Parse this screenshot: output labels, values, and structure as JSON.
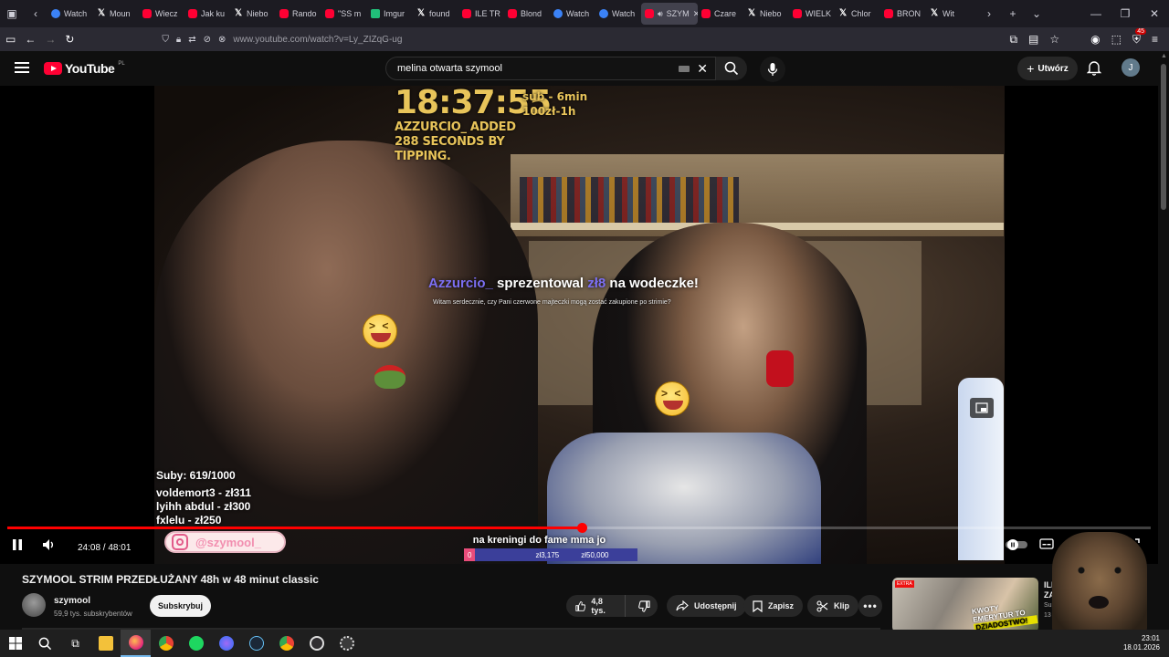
{
  "browser": {
    "tabs": [
      {
        "label": "Watch",
        "icon": "blue"
      },
      {
        "label": "Moun",
        "icon": "x"
      },
      {
        "label": "Wiecz",
        "icon": "yt"
      },
      {
        "label": "Jak ku",
        "icon": "yt"
      },
      {
        "label": "Niebo",
        "icon": "x"
      },
      {
        "label": "Rando",
        "icon": "yt"
      },
      {
        "label": "\"SS m",
        "icon": "yt"
      },
      {
        "label": "Imgur",
        "icon": "green"
      },
      {
        "label": "found",
        "icon": "x"
      },
      {
        "label": "ILE TR",
        "icon": "yt"
      },
      {
        "label": "Blond",
        "icon": "yt"
      },
      {
        "label": "Watch",
        "icon": "blue"
      },
      {
        "label": "Watch",
        "icon": "blue"
      },
      {
        "label": "SZYM",
        "icon": "yt",
        "active": true
      },
      {
        "label": "Czare",
        "icon": "yt"
      },
      {
        "label": "Niebo",
        "icon": "x"
      },
      {
        "label": "WIELK",
        "icon": "yt"
      },
      {
        "label": "Chlor",
        "icon": "x"
      },
      {
        "label": "BRON",
        "icon": "yt"
      },
      {
        "label": "Wit",
        "icon": "x"
      }
    ],
    "url": "www.youtube.com/watch?v=Ly_ZIZqG-ug",
    "extension_badge": "45"
  },
  "youtube": {
    "logo_text": "YouTube",
    "region": "PL",
    "search_value": "melina otwarta szymool",
    "create_label": "Utwórz",
    "avatar_letter": "J"
  },
  "video": {
    "overlay": {
      "clock": "18:37:55",
      "sub_line": "sub - 6min",
      "money_line": "100zł-1h",
      "added_line": "AZZURCIO_ ADDED 288 SECONDS BY TIPPING.",
      "alert_user": "Azzurcio_",
      "alert_mid": " sprezentowal ",
      "alert_amount": "zł8",
      "alert_end": " na wodeczke!",
      "alert_message": "Witam serdecznie, czy Pani czerwone majteczki mogą zostać zakupione po strimie?",
      "subs_count": "Suby: 619/1000",
      "donors": [
        "voldemort3 - zł311",
        "lyihh abdul - zł300",
        "fxlelu - zł250"
      ],
      "instagram": "@szymool_",
      "goal_title": "na kreningi do fame mma jo",
      "goal_start": "0",
      "goal_current": "zł3,175",
      "goal_target": "zł50,000",
      "goal_progress": 0.0635
    },
    "time_current": "24:08",
    "time_total": "48:01",
    "progress": 0.5027
  },
  "details": {
    "title": "SZYMOOL STRIM PRZEDŁUŻANY 48h w 48 minut classic",
    "channel": "szymool",
    "subscribers": "59,9 tys. subskrybentów",
    "subscribe_label": "Subskrybuj",
    "likes": "4,8 tys.",
    "share_label": "Udostępnij",
    "save_label": "Zapisz",
    "clip_label": "Klip"
  },
  "recommended": {
    "tag": "EXTRA",
    "thumb_caption_1": "KWOTY EMERYTUR TO",
    "thumb_caption_2": "DZIADOSTWO!",
    "title_1": "ILE T",
    "title_2": "ZAR",
    "channel": "Super",
    "views": "13 tys."
  },
  "taskbar": {
    "time": "23:01",
    "date": "18.01.2026"
  }
}
